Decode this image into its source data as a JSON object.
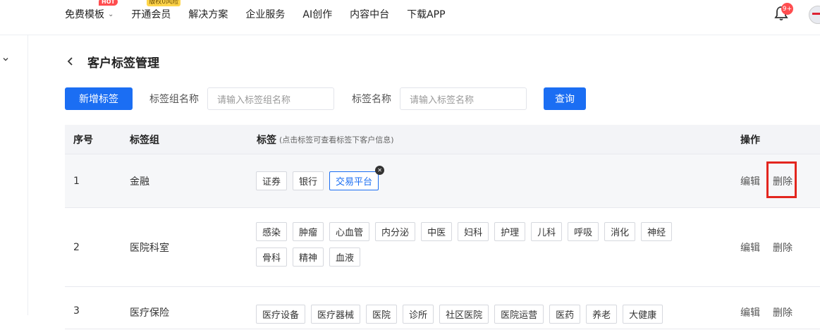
{
  "nav": {
    "items": [
      {
        "label": "免费模板",
        "badge": "HOT"
      },
      {
        "label": "开通会员",
        "badge": "版权0风险"
      },
      {
        "label": "解决方案"
      },
      {
        "label": "企业服务"
      },
      {
        "label": "AI创作"
      },
      {
        "label": "内容中台"
      },
      {
        "label": "下载APP"
      }
    ],
    "notification_count": "9+"
  },
  "page": {
    "title": "客户标签管理"
  },
  "filters": {
    "add_button": "新增标签",
    "group_label": "标签组名称",
    "group_placeholder": "请输入标签组名称",
    "name_label": "标签名称",
    "name_placeholder": "请输入标签名称",
    "query_button": "查询"
  },
  "table": {
    "headers": {
      "index": "序号",
      "group": "标签组",
      "tags": "标签",
      "tags_note": "(点击标签可查看标签下客户信息)",
      "actions": "操作"
    },
    "rows": [
      {
        "index": "1",
        "group": "金融",
        "tags": [
          "证券",
          "银行",
          "交易平台"
        ],
        "edit": "编辑",
        "delete": "删除"
      },
      {
        "index": "2",
        "group": "医院科室",
        "tags": [
          "感染",
          "肿瘤",
          "心血管",
          "内分泌",
          "中医",
          "妇科",
          "护理",
          "儿科",
          "呼吸",
          "消化",
          "神经",
          "骨科",
          "精神",
          "血液"
        ],
        "edit": "编辑",
        "delete": "删除"
      },
      {
        "index": "3",
        "group": "医疗保险",
        "tags": [
          "医疗设备",
          "医疗器械",
          "医院",
          "诊所",
          "社区医院",
          "医院运营",
          "医药",
          "养老",
          "大健康"
        ],
        "edit": "编辑",
        "delete": "删除"
      }
    ]
  },
  "colors": {
    "primary": "#1b6ef3",
    "highlight": "#e3261f"
  }
}
